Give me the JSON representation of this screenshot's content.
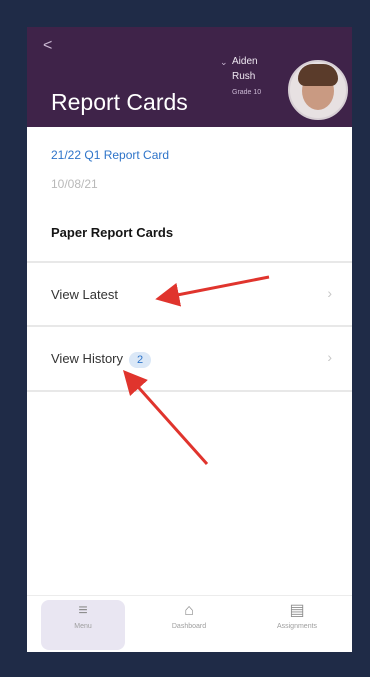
{
  "header": {
    "back_glyph": "<",
    "title": "Report Cards",
    "user_first": "Aiden",
    "user_last": "Rush",
    "user_grade": "Grade 10"
  },
  "report": {
    "link": "21/22 Q1 Report Card",
    "date": "10/08/21"
  },
  "section_title": "Paper Report Cards",
  "rows": [
    {
      "label": "View Latest"
    },
    {
      "label": "View History",
      "badge": "2"
    }
  ],
  "tabs": [
    {
      "label": "Menu",
      "icon": "menu-icon"
    },
    {
      "label": "Dashboard",
      "icon": "home-icon"
    },
    {
      "label": "Assignments",
      "icon": "assignments-icon"
    }
  ],
  "colors": {
    "header_bg": "#3f2349",
    "link": "#2e74c9",
    "annotation": "#e0342d"
  }
}
